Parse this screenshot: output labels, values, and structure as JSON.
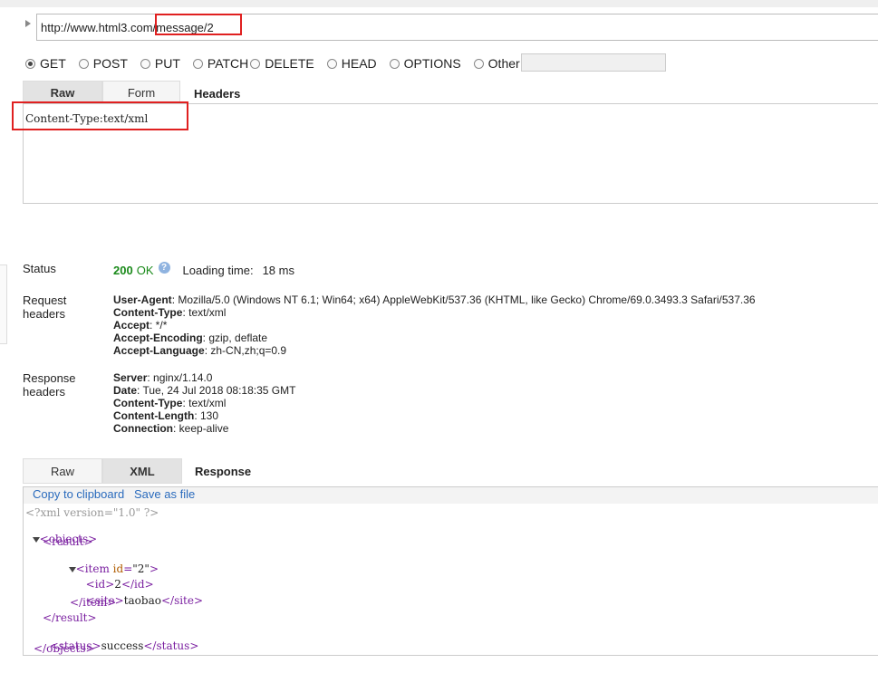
{
  "request": {
    "url": "http://www.html3.com/message/2",
    "methods": [
      {
        "label": "GET",
        "checked": true
      },
      {
        "label": "POST",
        "checked": false
      },
      {
        "label": "PUT",
        "checked": false
      },
      {
        "label": "PATCH",
        "checked": false
      },
      {
        "label": "DELETE",
        "checked": false
      },
      {
        "label": "HEAD",
        "checked": false
      },
      {
        "label": "OPTIONS",
        "checked": false
      },
      {
        "label": "Other",
        "checked": false
      }
    ],
    "other_value": "",
    "header_tabs": [
      "Raw",
      "Form"
    ],
    "headers_title": "Headers",
    "headers_text": "Content-Type:text/xml"
  },
  "status": {
    "label": "Status",
    "code": "200",
    "text": "OK",
    "loading_label": "Loading time:",
    "loading_value": "18 ms"
  },
  "request_headers": {
    "label_line1": "Request",
    "label_line2": "headers",
    "items": [
      {
        "key": "User-Agent",
        "value": ": Mozilla/5.0 (Windows NT 6.1; Win64; x64) AppleWebKit/537.36 (KHTML, like Gecko) Chrome/69.0.3493.3 Safari/537.36"
      },
      {
        "key": "Content-Type",
        "value": ": text/xml"
      },
      {
        "key": "Accept",
        "value": ": */*"
      },
      {
        "key": "Accept-Encoding",
        "value": ": gzip, deflate"
      },
      {
        "key": "Accept-Language",
        "value": ": zh-CN,zh;q=0.9"
      }
    ]
  },
  "response_headers": {
    "label_line1": "Response",
    "label_line2": "headers",
    "items": [
      {
        "key": "Server",
        "value": ": nginx/1.14.0"
      },
      {
        "key": "Date",
        "value": ": Tue, 24 Jul 2018 08:18:35 GMT"
      },
      {
        "key": "Content-Type",
        "value": ": text/xml"
      },
      {
        "key": "Content-Length",
        "value": ": 130"
      },
      {
        "key": "Connection",
        "value": ": keep-alive"
      }
    ]
  },
  "response": {
    "tabs": [
      "Raw",
      "XML"
    ],
    "title": "Response",
    "copy_label": "Copy to clipboard",
    "save_label": "Save as file",
    "xml_decl": "<?xml version=\"1.0\" ?>",
    "objects_tag": "objects",
    "result_tag": "result",
    "item_tag": "item",
    "item_attr_name": "id",
    "item_attr_value": "\"2\"",
    "id_tag": "id",
    "id_value": "2",
    "site_tag": "site",
    "site_value": "taobao",
    "status_tag": "status",
    "status_value": "success"
  },
  "colors": {
    "accent_red": "#e02020",
    "ok_green": "#1a8a1a",
    "link_blue": "#2a6bbd"
  }
}
